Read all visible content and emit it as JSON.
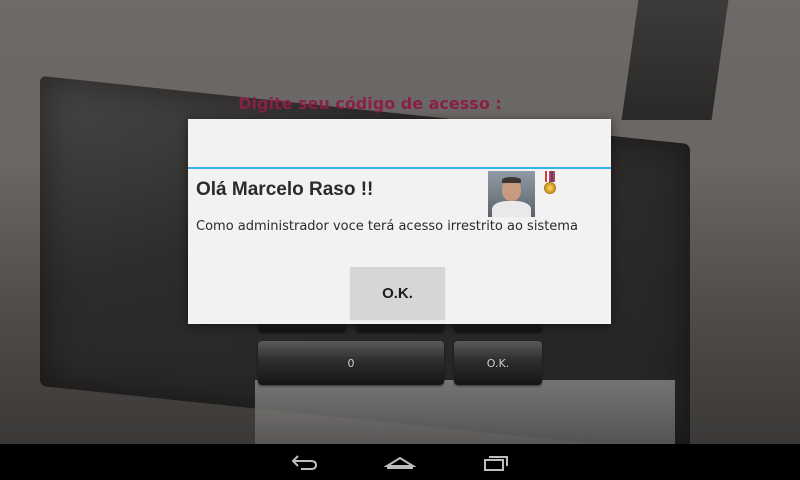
{
  "screen": {
    "prompt": "Digite seu código de acesso  :"
  },
  "keypad": {
    "keys": [
      {
        "label": ""
      },
      {
        "label": ""
      },
      {
        "label": ""
      },
      {
        "label": "0"
      },
      {
        "label": "O.K."
      }
    ]
  },
  "dialog": {
    "input_value": "",
    "title": "Olá Marcelo Raso !!",
    "message": "Como administrador voce terá acesso irrestrito ao sistema",
    "ok_label": "O.K.",
    "photo_icon": "user-photo",
    "medal_icon": "medal-icon",
    "accent_color": "#33b5e5"
  },
  "navbar": {
    "buttons": [
      {
        "icon": "back-icon"
      },
      {
        "icon": "home-icon"
      },
      {
        "icon": "recent-apps-icon"
      }
    ]
  },
  "colors": {
    "prompt": "#8a2046",
    "dialog_bg": "#f2f2f2",
    "navbar_bg": "#000000"
  }
}
